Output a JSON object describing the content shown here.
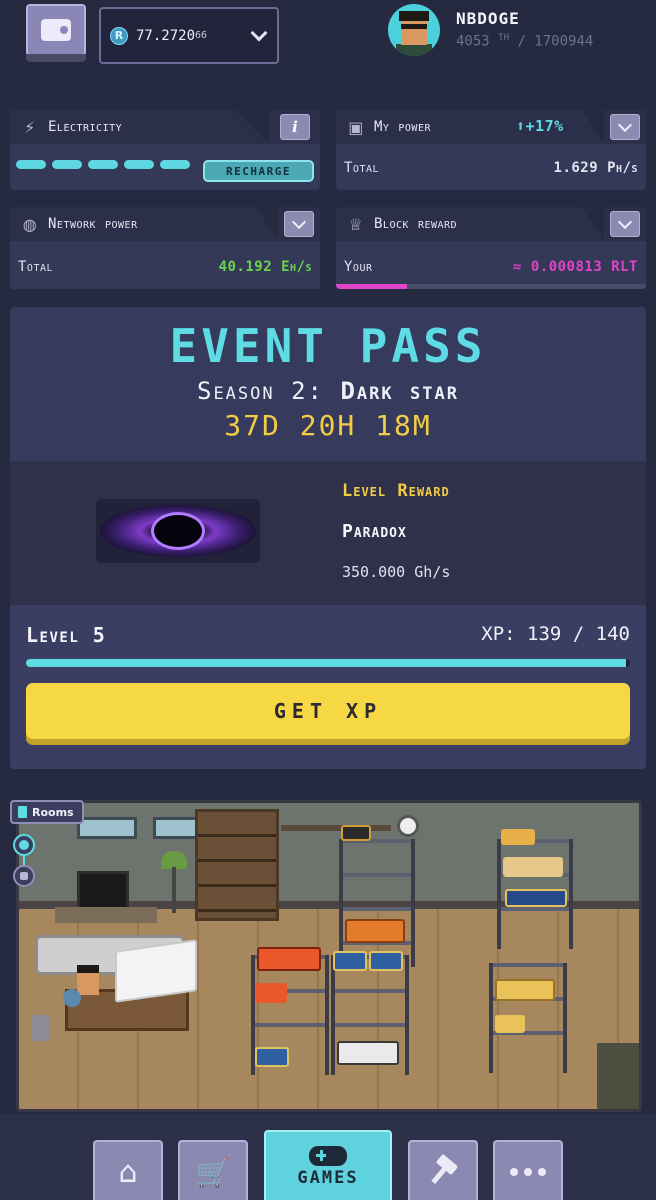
{
  "header": {
    "balance_main": "77.2720",
    "balance_small": "66",
    "coin_symbol": "R",
    "username": "NBDOGE",
    "rank": "4053",
    "rank_suffix": "TH",
    "rank_total": "/ 1700944"
  },
  "electricity": {
    "title": "Electricity",
    "info": "i",
    "recharge_label": "RECHARGE",
    "segments": 5
  },
  "my_power": {
    "title": "My power",
    "change": "+17%",
    "label": "Total",
    "value": "1.629 Ph/s"
  },
  "network_power": {
    "title": "Network power",
    "label": "Total",
    "value": "40.192 Eh/s"
  },
  "block_reward": {
    "title": "Block reward",
    "label": "Your",
    "value": "≈ 0.000813 RLT",
    "progress": 0.23
  },
  "event_pass": {
    "title": "EVENT PASS",
    "season_prefix": "Season 2:",
    "season_name": "Dark star",
    "timer": "37D 20H 18M",
    "level_reward_label": "Level Reward",
    "reward_name": "Paradox",
    "reward_power": "350.000 Gh/s",
    "level": "Level 5",
    "xp_text": "XP: 139 / 140",
    "xp_current": 139,
    "xp_max": 140,
    "get_xp_label": "GET XP"
  },
  "room": {
    "rooms_label": "Rooms"
  },
  "nav": {
    "games_label": "GAMES"
  },
  "colors": {
    "accent_cyan": "#5fdbe4",
    "accent_yellow": "#f5d843",
    "network_green": "#6cd44e",
    "reward_magenta": "#e044c9"
  }
}
